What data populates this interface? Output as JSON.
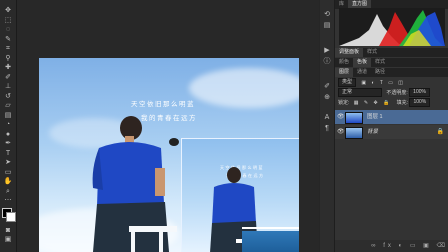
{
  "canvas": {
    "headline_line1": "天空依旧那么明蓝",
    "headline_line2": "我的青春在远方",
    "inset_line1": "天空依旧那么明蓝",
    "inset_line2": "我的青春在远方"
  },
  "panels": {
    "histogram_tabs": [
      "库",
      "直方图"
    ],
    "adjust_tabs": [
      "调整面板",
      "样式"
    ],
    "style_tabs": [
      "颜色",
      "色板",
      "样式"
    ],
    "layers_tabs": [
      "图层",
      "通道",
      "路径"
    ],
    "kind_filter": "类型",
    "blend_mode": "正常",
    "opacity_label": "不透明度:",
    "opacity_value": "100%",
    "lock_label": "锁定:",
    "fill_label": "填充:",
    "fill_value": "100%"
  },
  "layers": [
    {
      "name": "图层 1",
      "selected": true
    },
    {
      "name": "背景",
      "selected": false
    }
  ],
  "colors": {
    "accent_selected": "#4a6a95",
    "sky": "#8fbfee"
  }
}
